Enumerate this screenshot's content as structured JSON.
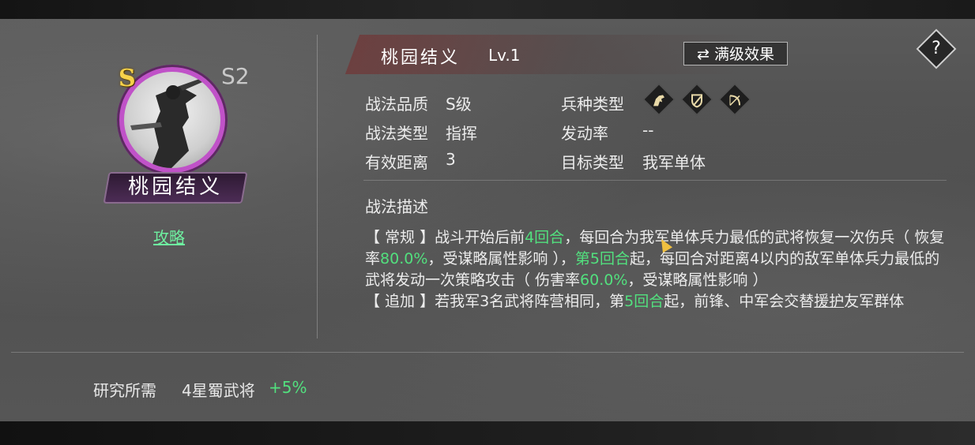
{
  "skill": {
    "grade_badge": "S",
    "season": "S2",
    "name": "桃园结义",
    "level": "Lv.1",
    "guide_link": "攻略",
    "max_effect_button": "⇄ 满级效果",
    "help_symbol": "?"
  },
  "info": {
    "quality_label": "战法品质",
    "quality_value": "S级",
    "type_label": "战法类型",
    "type_value": "指挥",
    "range_label": "有效距离",
    "range_value": "3",
    "troop_label": "兵种类型",
    "troop_icons": [
      "cavalry-icon",
      "shield-icon",
      "bow-icon"
    ],
    "rate_label": "发动率",
    "rate_value": "--",
    "target_label": "目标类型",
    "target_value": "我军单体"
  },
  "description": {
    "title": "战法描述",
    "p1_a": "【 常规 】战斗开始后前",
    "p1_h1": "4回合",
    "p1_b": "，每回合为我军单体兵力最低的武将恢复一次伤兵（ 恢复率",
    "p1_h2": "80.0%",
    "p1_c": "，受谋略属性影响 ），",
    "p1_h3": "第5回合",
    "p1_d": "起，每回合对距离4以内的敌军单体兵力最低的武将发动一次策略攻击（ 伤害率",
    "p1_h4": "60.0%",
    "p1_e": "，受谋略属性影响 ）",
    "p2_a": "【 追加 】若我军3名武将阵营相同，第",
    "p2_h1": "5回合",
    "p2_b": "起，前锋、中军会交替",
    "p2_u": "援护",
    "p2_c": "友军群体"
  },
  "research": {
    "label": "研究所需",
    "value": "4星蜀武将",
    "bonus": "+5%"
  },
  "colors": {
    "highlight": "#52e07e",
    "grade_gold": "#f6d24a",
    "ring_purple": "#c052c8"
  }
}
